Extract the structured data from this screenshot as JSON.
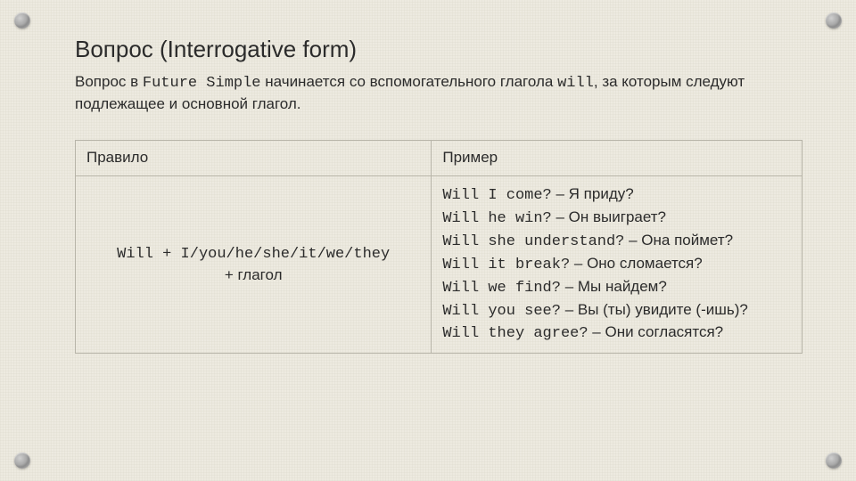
{
  "heading": "Вопрос (Interrogative form)",
  "intro": {
    "part1": "Вопрос в ",
    "futureSimple": "Future Simple",
    "part2": " начинается со вспомогательного глагола ",
    "will": "will",
    "part3": ", за которым следуют подлежащее и основной глагол."
  },
  "table": {
    "header": {
      "left": "Правило",
      "right": "Пример"
    },
    "rule": {
      "line1_mono": "Will + I/you/he/she/it/we/they",
      "line2": "+ глагол"
    },
    "examples": [
      {
        "mono": "Will I come?",
        "trans": " – Я приду?"
      },
      {
        "mono": "Will he win?",
        "trans": " – Он выиграет?"
      },
      {
        "mono": "Will she understand?",
        "trans": " – Она поймет?"
      },
      {
        "mono": "Will it break?",
        "trans": " – Оно сломается?"
      },
      {
        "mono": "Will we find?",
        "trans": " – Мы найдем?"
      },
      {
        "mono": "Will you see?",
        "trans": " – Вы (ты) увидите (-ишь)?"
      },
      {
        "mono": "Will they agree?",
        "trans": " – Они согласятся?"
      }
    ]
  }
}
